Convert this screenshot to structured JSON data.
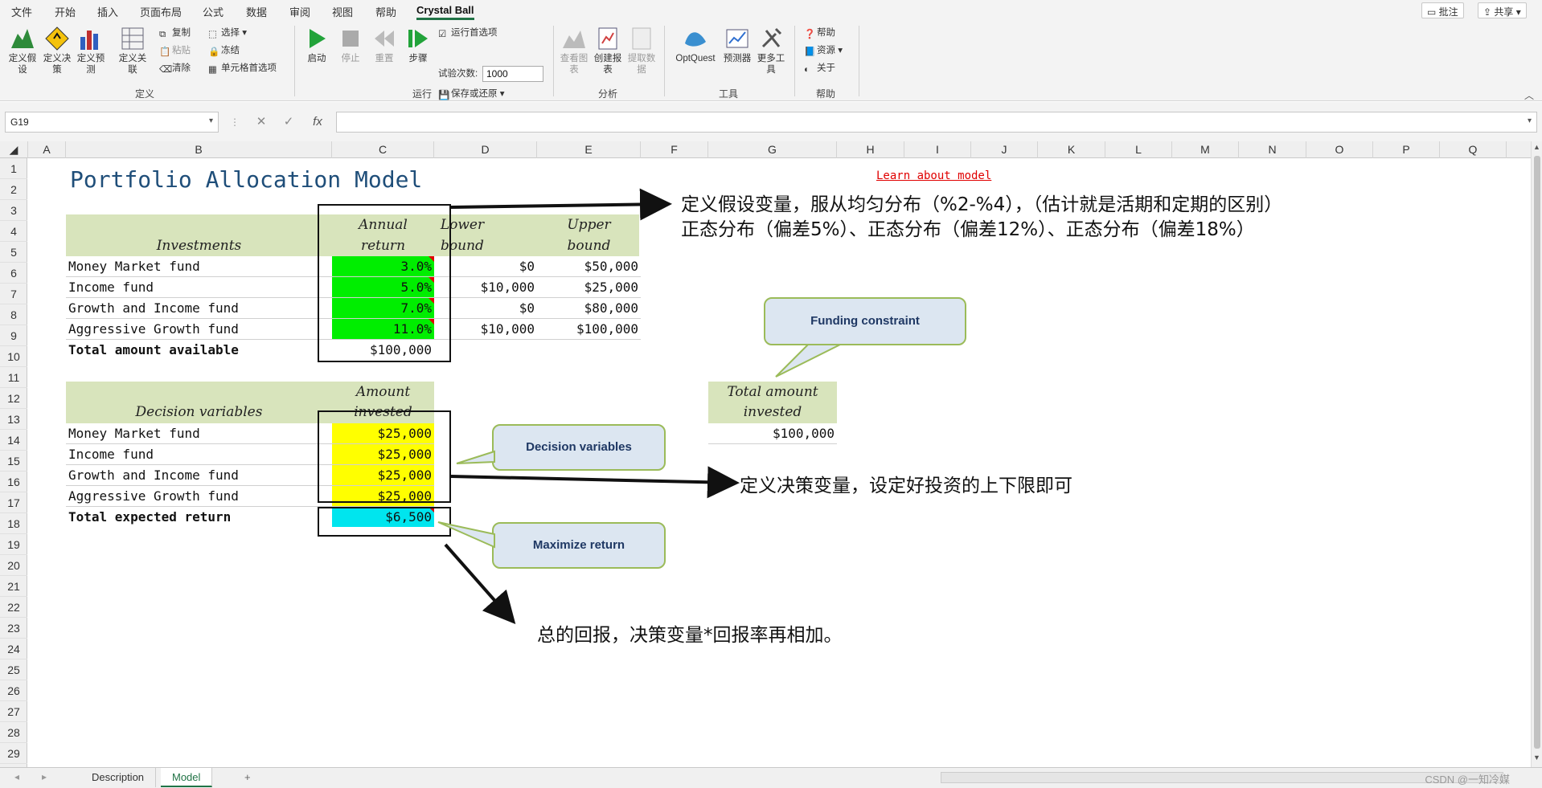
{
  "menu": {
    "tabs": [
      "文件",
      "开始",
      "插入",
      "页面布局",
      "公式",
      "数据",
      "审阅",
      "视图",
      "帮助",
      "Crystal Ball"
    ],
    "active_tab": "Crystal Ball",
    "comment_label": "批注",
    "share_label": "共享"
  },
  "ribbon": {
    "groups": {
      "define": "定义",
      "run": "运行",
      "analyze": "分析",
      "tools": "工具",
      "help": "帮助"
    },
    "define_assumption": "定义假设",
    "define_decision": "定义决策",
    "define_forecast": "定义预测",
    "define_correlation": "定义关联",
    "copy": "复制",
    "paste": "粘贴",
    "clear": "清除",
    "select": "选择",
    "freeze": "冻结",
    "cell_prefs": "单元格首选项",
    "start": "启动",
    "stop": "停止",
    "reset": "重置",
    "step": "步骤",
    "run_prefs": "运行首选项",
    "trials_label": "试验次数:",
    "trials_value": "1000",
    "save_restore": "保存或还原",
    "view_charts": "查看图表",
    "create_report": "创建报表",
    "extract_data": "提取数据",
    "optquest": "OptQuest",
    "predictor": "预测器",
    "more_tools": "更多工具",
    "help": "帮助",
    "resources": "资源",
    "about": "关于"
  },
  "formula_bar": {
    "name_box": "G19",
    "cancel_icon": "✕",
    "enter_icon": "✓",
    "fx_label": "fx",
    "formula": ""
  },
  "columns": [
    "A",
    "B",
    "C",
    "D",
    "E",
    "F",
    "G",
    "H",
    "I",
    "J",
    "K",
    "L",
    "M",
    "N",
    "O",
    "P",
    "Q"
  ],
  "rows": [
    "1",
    "2",
    "3",
    "4",
    "5",
    "6",
    "7",
    "8",
    "9",
    "10",
    "11",
    "12",
    "13",
    "14",
    "15",
    "16",
    "17",
    "18",
    "19",
    "20",
    "21",
    "22",
    "23",
    "24",
    "25",
    "26",
    "27",
    "28",
    "29"
  ],
  "sheet": {
    "title": "Portfolio Allocation Model",
    "learn_link": "Learn about model",
    "inv_header": {
      "investments": "Investments",
      "annual_return_1": "Annual",
      "annual_return_2": "return",
      "lower_1": "Lower",
      "lower_2": "bound",
      "upper_1": "Upper",
      "upper_2": "bound"
    },
    "investments": [
      {
        "name": "Money Market fund",
        "return": "3.0%",
        "lower": "$0",
        "upper": "$50,000"
      },
      {
        "name": "Income fund",
        "return": "5.0%",
        "lower": "$10,000",
        "upper": "$25,000"
      },
      {
        "name": "Growth and Income fund",
        "return": "7.0%",
        "lower": "$0",
        "upper": "$80,000"
      },
      {
        "name": "Aggressive Growth fund",
        "return": "11.0%",
        "lower": "$10,000",
        "upper": "$100,000"
      }
    ],
    "total_available_label": "Total amount available",
    "total_available_value": "$100,000",
    "dec_header": {
      "decision_variables": "Decision variables",
      "amount_1": "Amount",
      "amount_2": "invested"
    },
    "decisions": [
      {
        "name": "Money Market fund",
        "amount": "$25,000"
      },
      {
        "name": "Income fund",
        "amount": "$25,000"
      },
      {
        "name": "Growth and Income fund",
        "amount": "$25,000"
      },
      {
        "name": "Aggressive Growth fund",
        "amount": "$25,000"
      }
    ],
    "total_return_label": "Total expected return",
    "total_return_value": "$6,500",
    "total_invested_1": "Total amount",
    "total_invested_2": "invested",
    "total_invested_value": "$100,000"
  },
  "annotations": {
    "note_assumption_1": "定义假设变量，服从均匀分布（%2-%4），（估计就是活期和定期的区别）",
    "note_assumption_2": "正态分布（偏差5%）、正态分布（偏差12%）、正态分布（偏差18%）",
    "note_decision": "定义决策变量，设定好投资的上下限即可",
    "note_return": "总的回报，决策变量*回报率再相加。",
    "callout_funding": "Funding constraint",
    "callout_decision": "Decision variables",
    "callout_maximize": "Maximize return"
  },
  "tabs": {
    "description": "Description",
    "model": "Model",
    "add": "+"
  },
  "watermark": "CSDN @一知冷媒"
}
